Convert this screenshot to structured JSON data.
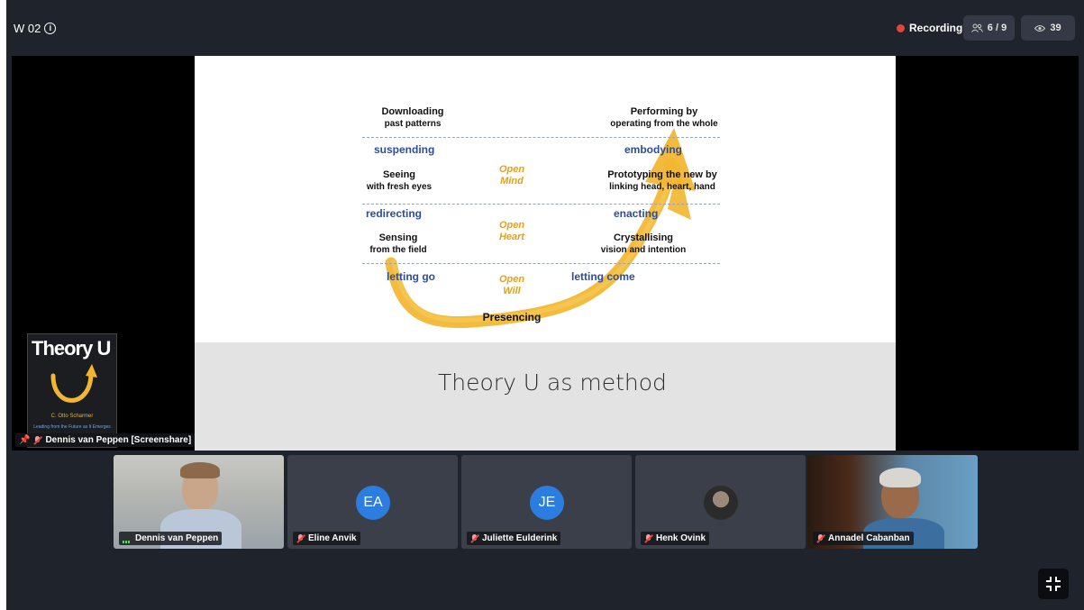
{
  "header": {
    "room_name": "W 02",
    "recording_label": "Recording",
    "participants_count": "6 / 9",
    "viewers_count": "39"
  },
  "colors": {
    "background": "#1f232b",
    "recording": "#e2463a",
    "avatar": "#2b7de0",
    "theory_u_arrow": "#f2b630",
    "slide_blue_text": "#2d4d98"
  },
  "screenshare": {
    "label": "Dennis van Peppen [Screenshare]",
    "slide": {
      "title": "Theory U as method",
      "left_levels": [
        {
          "main": "Downloading",
          "sub": "past patterns"
        },
        {
          "main": "Seeing",
          "sub": "with fresh eyes"
        },
        {
          "main": "Sensing",
          "sub": "from the field"
        }
      ],
      "right_levels": [
        {
          "main": "Performing by",
          "sub": "operating from the whole"
        },
        {
          "main": "Prototyping the new by",
          "sub": "linking head, heart, hand"
        },
        {
          "main": "Crystallising",
          "sub": "vision and intention"
        }
      ],
      "left_movements": [
        "suspending",
        "redirecting",
        "letting go"
      ],
      "right_movements": [
        "embodying",
        "enacting",
        "letting come"
      ],
      "open_levels": [
        {
          "l1": "Open",
          "l2": "Mind"
        },
        {
          "l1": "Open",
          "l2": "Heart"
        },
        {
          "l1": "Open",
          "l2": "Will"
        }
      ],
      "bottom": "Presencing",
      "book": {
        "title": "Theory U",
        "author": "C. Otto Scharmer",
        "subtitle": "Leading from the Future as It Emerges"
      }
    }
  },
  "participants": [
    {
      "name": "Dennis van Peppen",
      "type": "video",
      "muted": false
    },
    {
      "name": "Eline Anvik",
      "initials": "EA",
      "type": "initials",
      "muted": true
    },
    {
      "name": "Juliette Eulderink",
      "initials": "JE",
      "type": "initials",
      "muted": true
    },
    {
      "name": "Henk Ovink",
      "type": "avatar",
      "muted": true
    },
    {
      "name": "Annadel Cabanban",
      "type": "video",
      "muted": true
    }
  ]
}
